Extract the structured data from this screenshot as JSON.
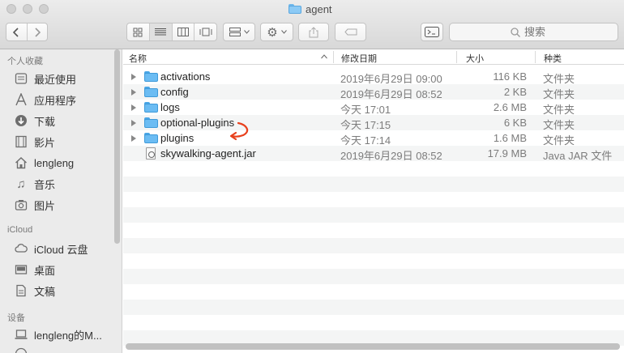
{
  "window": {
    "title": "agent"
  },
  "toolbar": {
    "back_icon": "chevron-left-icon",
    "forward_icon": "chevron-right-icon",
    "search_placeholder": "搜索"
  },
  "sidebar": {
    "sections": [
      {
        "label": "个人收藏",
        "items": [
          {
            "label": "最近使用",
            "icon": "recents-icon"
          },
          {
            "label": "应用程序",
            "icon": "applications-icon"
          },
          {
            "label": "下载",
            "icon": "download-icon"
          },
          {
            "label": "影片",
            "icon": "movies-icon"
          },
          {
            "label": "lengleng",
            "icon": "home-icon"
          },
          {
            "label": "音乐",
            "icon": "music-icon"
          },
          {
            "label": "图片",
            "icon": "pictures-icon"
          }
        ]
      },
      {
        "label": "iCloud",
        "items": [
          {
            "label": "iCloud 云盘",
            "icon": "cloud-icon"
          },
          {
            "label": "桌面",
            "icon": "desktop-icon"
          },
          {
            "label": "文稿",
            "icon": "document-icon"
          }
        ]
      },
      {
        "label": "设备",
        "items": [
          {
            "label": "lengleng的M...",
            "icon": "computer-icon"
          }
        ]
      }
    ]
  },
  "columns": {
    "name": "名称",
    "date": "修改日期",
    "size": "大小",
    "kind": "种类"
  },
  "files": [
    {
      "name": "activations",
      "date": "2019年6月29日 09:00",
      "size": "116 KB",
      "kind": "文件夹",
      "type": "folder"
    },
    {
      "name": "config",
      "date": "2019年6月29日 08:52",
      "size": "2 KB",
      "kind": "文件夹",
      "type": "folder"
    },
    {
      "name": "logs",
      "date": "今天 17:01",
      "size": "2.6 MB",
      "kind": "文件夹",
      "type": "folder"
    },
    {
      "name": "optional-plugins",
      "date": "今天 17:15",
      "size": "6 KB",
      "kind": "文件夹",
      "type": "folder"
    },
    {
      "name": "plugins",
      "date": "今天 17:14",
      "size": "1.6 MB",
      "kind": "文件夹",
      "type": "folder"
    },
    {
      "name": "skywalking-agent.jar",
      "date": "2019年6月29日 08:52",
      "size": "17.9 MB",
      "kind": "Java JAR 文件",
      "type": "jar"
    }
  ],
  "annotation": {
    "color": "#e8401c",
    "target": "optional-plugins"
  }
}
